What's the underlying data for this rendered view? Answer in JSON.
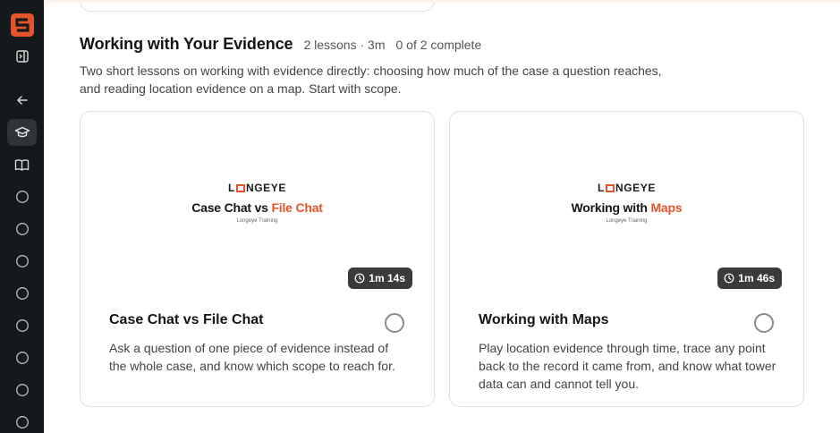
{
  "sidebar": {
    "icons": [
      "logo-icon",
      "toggle-sidebar-icon",
      "back-arrow-icon",
      "graduation-cap-icon",
      "book-icon",
      "lesson-circle-icon"
    ],
    "lesson_count": 8
  },
  "section": {
    "title": "Working with Your Evidence",
    "meta": "2 lessons · 3m",
    "progress": "0 of 2 complete",
    "description": "Two short lessons on working with evidence directly: choosing how much of the case a question reaches, and reading location evidence on a map. Start with scope."
  },
  "lessons": [
    {
      "brand": "LONGEYE",
      "thumb_title_plain": "Case Chat vs ",
      "thumb_title_accent": "File Chat",
      "thumb_sub": "Longeye Training",
      "duration": "1m 14s",
      "title": "Case Chat vs File Chat",
      "description": "Ask a question of one piece of evidence instead of the whole case, and know which scope to reach for.",
      "completed": false
    },
    {
      "brand": "LONGEYE",
      "thumb_title_plain": "Working with ",
      "thumb_title_accent": "Maps",
      "thumb_sub": "Longeye Training",
      "duration": "1m 46s",
      "title": "Working with Maps",
      "description": "Play location evidence through time, trace any point back to the record it came from, and know what tower data can and cannot tell you.",
      "completed": false
    }
  ],
  "colors": {
    "accent": "#e5532a",
    "sidebar_bg": "#14191b",
    "page_bg": "#fbf3ee"
  }
}
